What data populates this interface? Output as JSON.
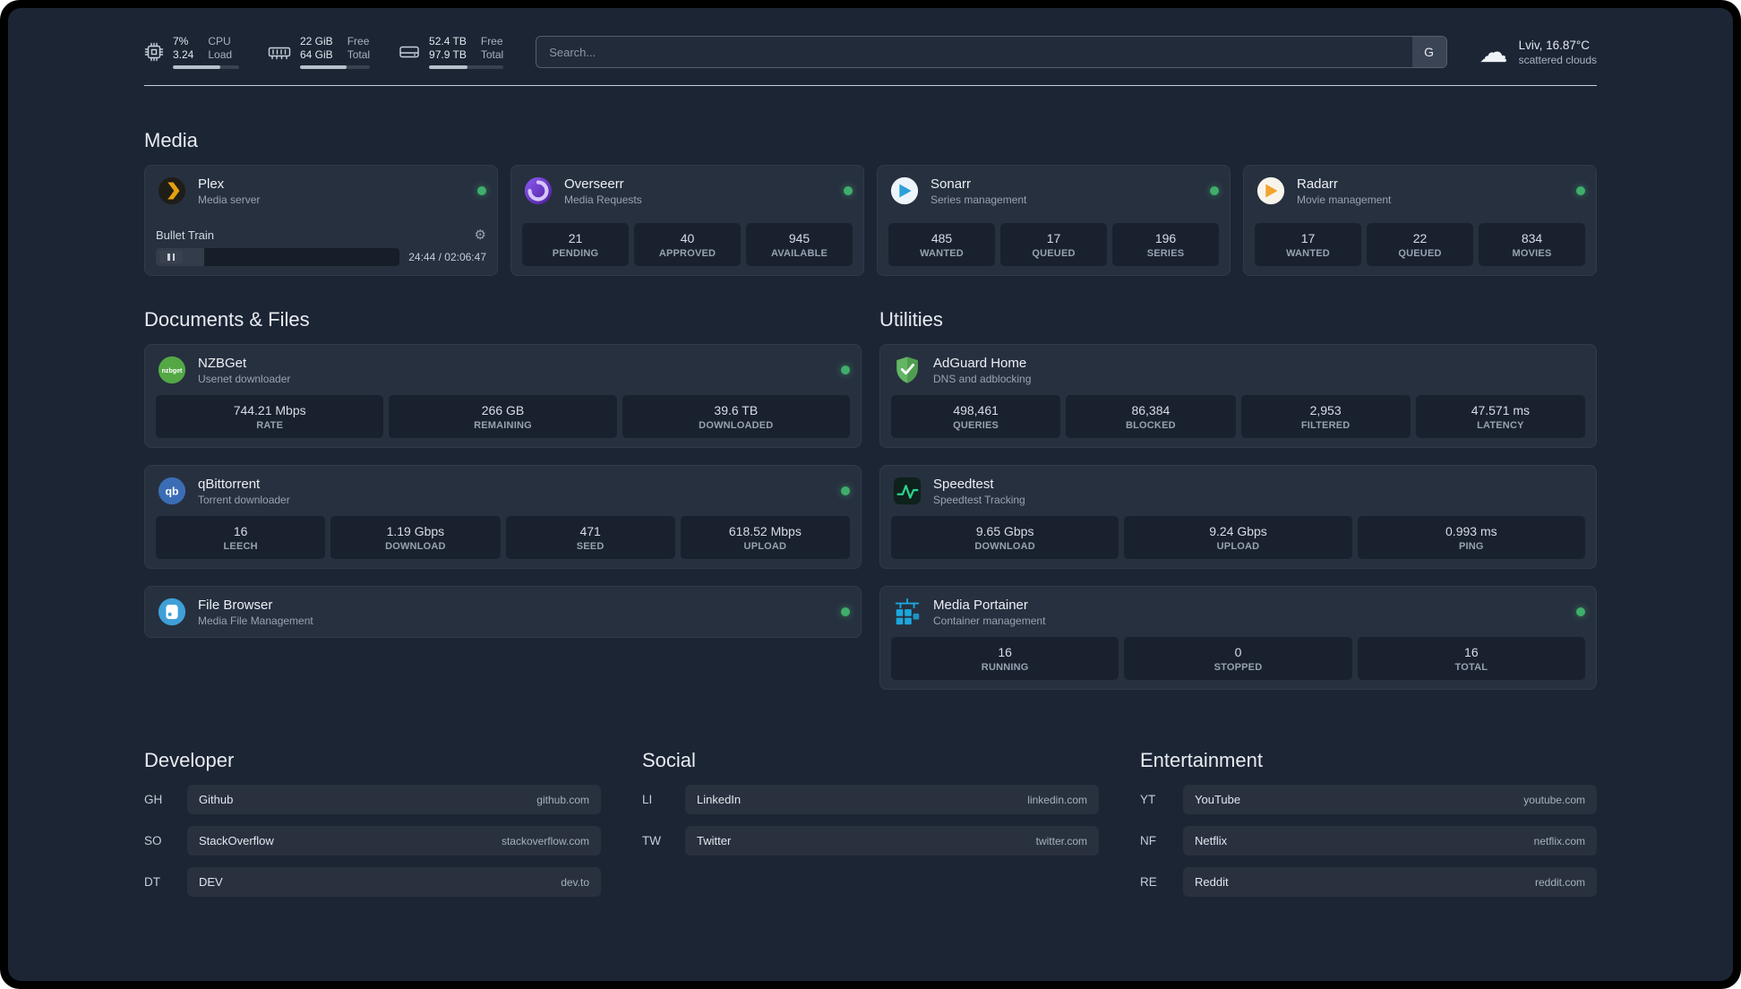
{
  "colors": {
    "background": "#1c2534",
    "card": "#27303f",
    "status_online": "#3fae6c",
    "plex": "#e5a00d",
    "overseerr": "#7c3aed",
    "sonarr": "#2ba0d8",
    "radarr": "#f0a32e",
    "nzbget": "#53a845",
    "qbittorrent": "#3a6db5",
    "adguard": "#63b663",
    "speedtest": "#2fd08c",
    "filebrowser": "#3f9fd8",
    "portainer": "#1ba7dd"
  },
  "topbar": {
    "resources": [
      {
        "icon": "cpu-icon",
        "col1": [
          "7%",
          "3.24"
        ],
        "col2": [
          "CPU",
          "Load"
        ],
        "progress": 0.72
      },
      {
        "icon": "memory-icon",
        "col1": [
          "22 GiB",
          "64 GiB"
        ],
        "col2": [
          "Free",
          "Total"
        ],
        "progress": 0.66
      },
      {
        "icon": "disk-icon",
        "col1": [
          "52.4 TB",
          "97.9 TB"
        ],
        "col2": [
          "Free",
          "Total"
        ],
        "progress": 0.52
      }
    ],
    "search": {
      "placeholder": "Search...",
      "button_label": "G"
    },
    "weather": {
      "location": "Lviv, 16.87°C",
      "condition": "scattered clouds"
    }
  },
  "sections": {
    "media": {
      "title": "Media",
      "plex": {
        "name": "Plex",
        "subtitle": "Media server",
        "online": true,
        "player": {
          "track": "Bullet Train",
          "time": "24:44 / 02:06:47",
          "progress": 0.2
        }
      },
      "overseerr": {
        "name": "Overseerr",
        "subtitle": "Media Requests",
        "online": true,
        "stats": [
          {
            "value": "21",
            "label": "PENDING"
          },
          {
            "value": "40",
            "label": "APPROVED"
          },
          {
            "value": "945",
            "label": "AVAILABLE"
          }
        ]
      },
      "sonarr": {
        "name": "Sonarr",
        "subtitle": "Series management",
        "online": true,
        "stats": [
          {
            "value": "485",
            "label": "WANTED"
          },
          {
            "value": "17",
            "label": "QUEUED"
          },
          {
            "value": "196",
            "label": "SERIES"
          }
        ]
      },
      "radarr": {
        "name": "Radarr",
        "subtitle": "Movie management",
        "online": true,
        "stats": [
          {
            "value": "17",
            "label": "WANTED"
          },
          {
            "value": "22",
            "label": "QUEUED"
          },
          {
            "value": "834",
            "label": "MOVIES"
          }
        ]
      }
    },
    "documents": {
      "title": "Documents & Files",
      "nzbget": {
        "name": "NZBGet",
        "subtitle": "Usenet downloader",
        "online": true,
        "stats": [
          {
            "value": "744.21 Mbps",
            "label": "RATE"
          },
          {
            "value": "266 GB",
            "label": "REMAINING"
          },
          {
            "value": "39.6 TB",
            "label": "DOWNLOADED"
          }
        ]
      },
      "qbittorrent": {
        "name": "qBittorrent",
        "subtitle": "Torrent downloader",
        "online": true,
        "stats": [
          {
            "value": "16",
            "label": "LEECH"
          },
          {
            "value": "1.19 Gbps",
            "label": "DOWNLOAD"
          },
          {
            "value": "471",
            "label": "SEED"
          },
          {
            "value": "618.52 Mbps",
            "label": "UPLOAD"
          }
        ]
      },
      "filebrowser": {
        "name": "File Browser",
        "subtitle": "Media File Management",
        "online": true
      }
    },
    "utilities": {
      "title": "Utilities",
      "adguard": {
        "name": "AdGuard Home",
        "subtitle": "DNS and adblocking",
        "stats": [
          {
            "value": "498,461",
            "label": "QUERIES"
          },
          {
            "value": "86,384",
            "label": "BLOCKED"
          },
          {
            "value": "2,953",
            "label": "FILTERED"
          },
          {
            "value": "47.571 ms",
            "label": "LATENCY"
          }
        ]
      },
      "speedtest": {
        "name": "Speedtest",
        "subtitle": "Speedtest Tracking",
        "stats": [
          {
            "value": "9.65 Gbps",
            "label": "DOWNLOAD"
          },
          {
            "value": "9.24 Gbps",
            "label": "UPLOAD"
          },
          {
            "value": "0.993 ms",
            "label": "PING"
          }
        ]
      },
      "portainer": {
        "name": "Media Portainer",
        "subtitle": "Container management",
        "online": true,
        "stats": [
          {
            "value": "16",
            "label": "RUNNING"
          },
          {
            "value": "0",
            "label": "STOPPED"
          },
          {
            "value": "16",
            "label": "TOTAL"
          }
        ]
      }
    }
  },
  "bookmarks": {
    "developer": {
      "title": "Developer",
      "items": [
        {
          "abbr": "GH",
          "name": "Github",
          "domain": "github.com"
        },
        {
          "abbr": "SO",
          "name": "StackOverflow",
          "domain": "stackoverflow.com"
        },
        {
          "abbr": "DT",
          "name": "DEV",
          "domain": "dev.to"
        }
      ]
    },
    "social": {
      "title": "Social",
      "items": [
        {
          "abbr": "LI",
          "name": "LinkedIn",
          "domain": "linkedin.com"
        },
        {
          "abbr": "TW",
          "name": "Twitter",
          "domain": "twitter.com"
        }
      ]
    },
    "entertainment": {
      "title": "Entertainment",
      "items": [
        {
          "abbr": "YT",
          "name": "YouTube",
          "domain": "youtube.com"
        },
        {
          "abbr": "NF",
          "name": "Netflix",
          "domain": "netflix.com"
        },
        {
          "abbr": "RE",
          "name": "Reddit",
          "domain": "reddit.com"
        }
      ]
    }
  }
}
